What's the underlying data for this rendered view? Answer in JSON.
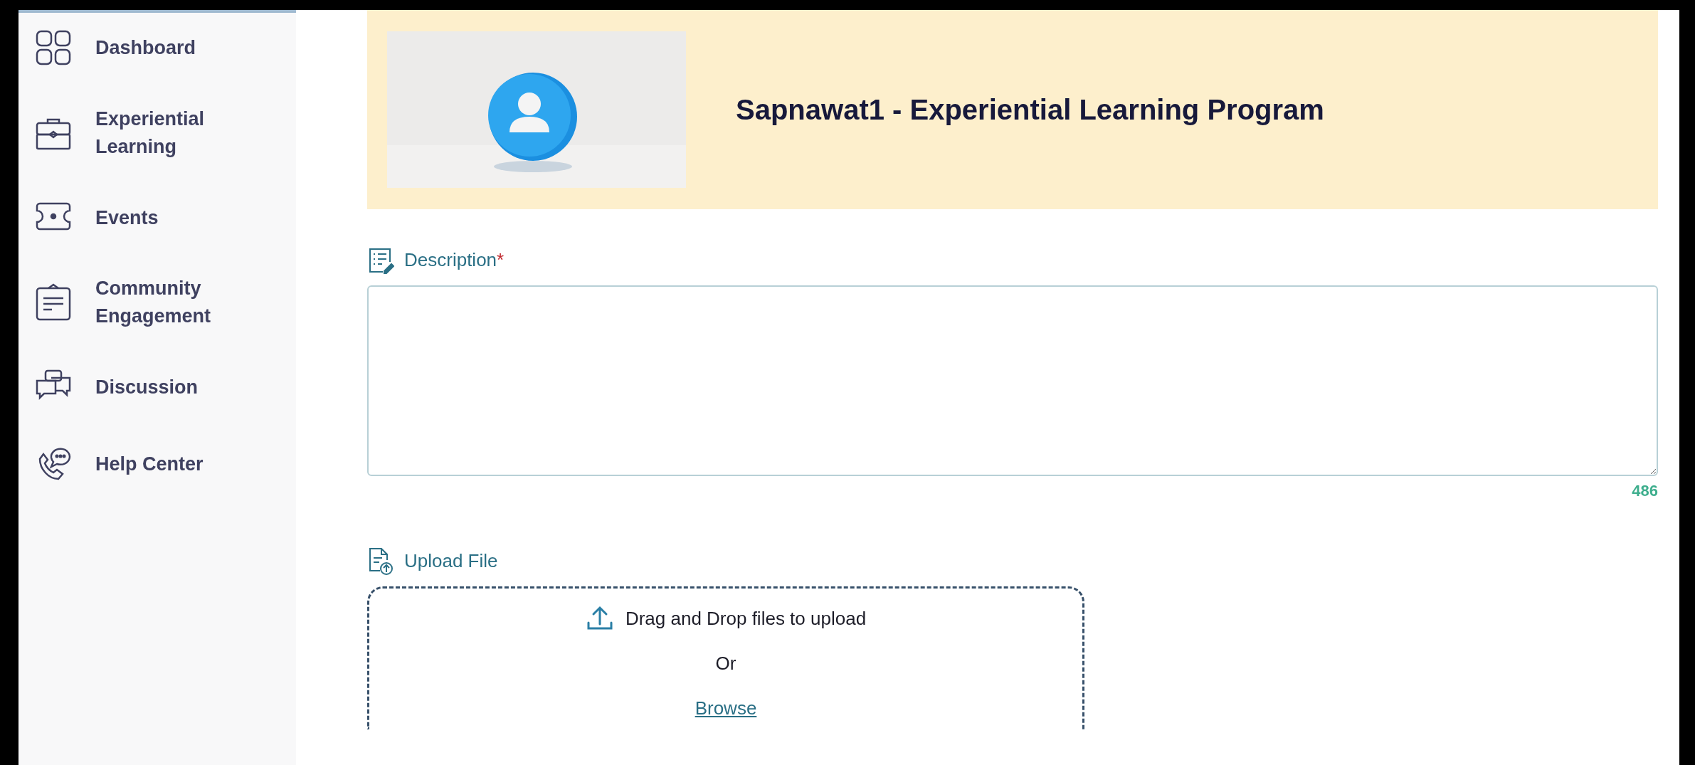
{
  "sidebar": {
    "items": [
      {
        "label": "Dashboard"
      },
      {
        "label": "Experiential Learning"
      },
      {
        "label": "Events"
      },
      {
        "label": "Community Engagement"
      },
      {
        "label": "Discussion"
      },
      {
        "label": "Help Center"
      }
    ]
  },
  "header": {
    "title": "Sapnawat1 - Experiential Learning Program"
  },
  "description": {
    "label": "Description",
    "required_mark": "*",
    "counter": "486"
  },
  "upload": {
    "label": "Upload File",
    "prompt": "Drag and Drop files to upload",
    "separator": "Or",
    "browse": "Browse"
  }
}
